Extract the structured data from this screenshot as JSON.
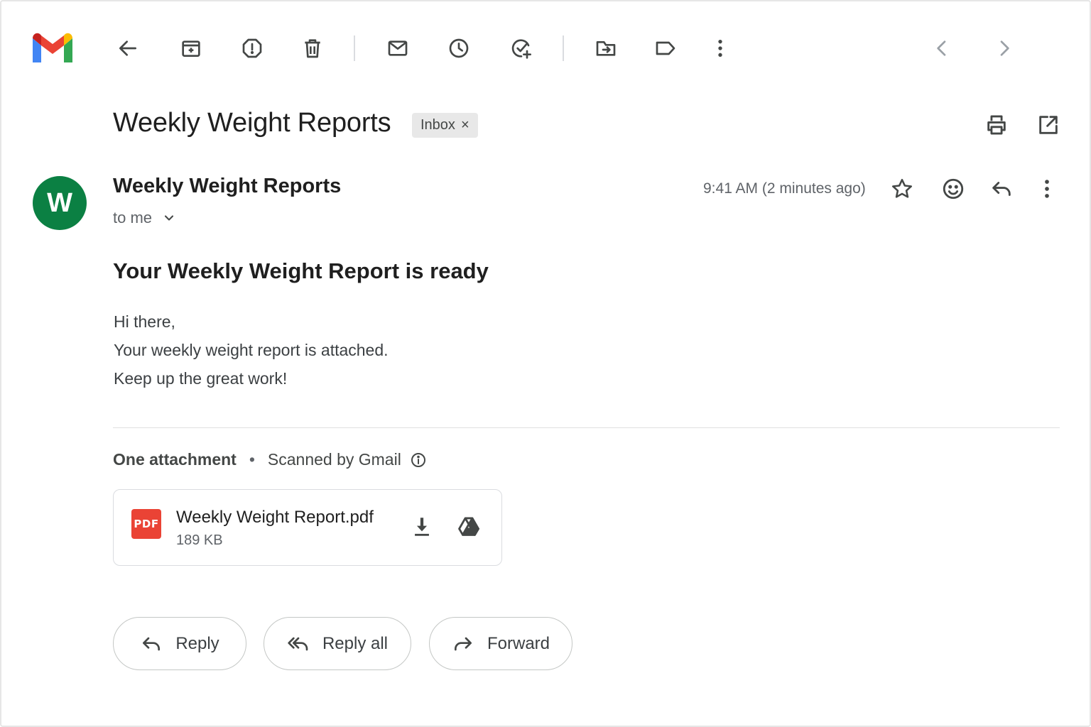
{
  "toolbar": {
    "logo": "gmail-logo",
    "actions": [
      {
        "name": "back",
        "icon": "arrow-left-icon"
      },
      {
        "name": "archive",
        "icon": "archive-icon"
      },
      {
        "name": "report-spam",
        "icon": "report-spam-icon"
      },
      {
        "name": "delete",
        "icon": "trash-icon"
      },
      {
        "name": "mark-unread",
        "icon": "envelope-icon"
      },
      {
        "name": "snooze",
        "icon": "clock-icon"
      },
      {
        "name": "add-to-tasks",
        "icon": "task-add-icon"
      },
      {
        "name": "move-to",
        "icon": "folder-move-icon"
      },
      {
        "name": "labels",
        "icon": "label-icon"
      },
      {
        "name": "more",
        "icon": "more-vert-icon"
      }
    ],
    "nav": [
      {
        "name": "newer",
        "icon": "chevron-left-icon"
      },
      {
        "name": "older",
        "icon": "chevron-right-icon"
      }
    ]
  },
  "thread": {
    "subject": "Weekly Weight Reports",
    "label": "Inbox",
    "label_remove": "×",
    "header_actions": [
      {
        "name": "print-all",
        "icon": "print-icon"
      },
      {
        "name": "open-new-window",
        "icon": "open-in-new-icon"
      }
    ]
  },
  "message": {
    "avatar_letter": "W",
    "avatar_color": "#0b8043",
    "sender": "Weekly Weight Reports",
    "recipient": "to me",
    "time": "9:41 AM (2 minutes ago)",
    "actions": [
      {
        "name": "star",
        "icon": "star-icon"
      },
      {
        "name": "add-reaction",
        "icon": "emoji-icon"
      },
      {
        "name": "reply",
        "icon": "reply-icon"
      },
      {
        "name": "more",
        "icon": "more-vert-icon"
      }
    ],
    "body_title": "Your Weekly Weight Report is ready",
    "body_lines": [
      "Hi there,",
      "Your weekly weight report is attached.",
      "Keep up the great work!"
    ]
  },
  "attachments": {
    "count_label": "One attachment",
    "separator": "•",
    "scanned_label": "Scanned by Gmail",
    "items": [
      {
        "type_badge": "PDF",
        "badge_color": "#ea4335",
        "name": "Weekly Weight Report.pdf",
        "size": "189 KB"
      }
    ]
  },
  "footer_actions": {
    "reply": "Reply",
    "reply_all": "Reply all",
    "forward": "Forward"
  }
}
